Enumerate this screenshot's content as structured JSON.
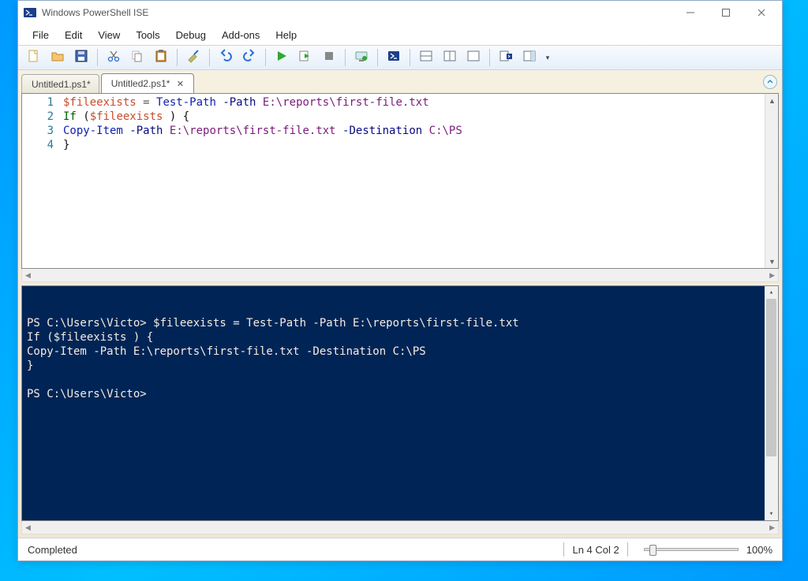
{
  "titlebar": {
    "title": "Windows PowerShell ISE"
  },
  "menubar": [
    "File",
    "Edit",
    "View",
    "Tools",
    "Debug",
    "Add-ons",
    "Help"
  ],
  "toolbar": [
    "new-file",
    "open-file",
    "save-file",
    "|",
    "cut",
    "copy",
    "paste",
    "|",
    "clear",
    "|",
    "undo",
    "redo",
    "|",
    "run",
    "run-selection",
    "stop",
    "|",
    "remote",
    "|",
    "powershell-tab",
    "|",
    "layout-1",
    "layout-2",
    "layout-3",
    "|",
    "show-command",
    "show-command-addon"
  ],
  "tabs": [
    {
      "label": "Untitled1.ps1*",
      "active": false,
      "closable": false
    },
    {
      "label": "Untitled2.ps1*",
      "active": true,
      "closable": true
    }
  ],
  "editor": {
    "line_numbers": [
      "1",
      "2",
      "3",
      "4"
    ],
    "lines": [
      [
        {
          "c": "tok-var",
          "t": "$fileexists"
        },
        {
          "c": "",
          "t": " "
        },
        {
          "c": "tok-op",
          "t": "="
        },
        {
          "c": "",
          "t": " "
        },
        {
          "c": "tok-cmd",
          "t": "Test-Path"
        },
        {
          "c": "",
          "t": " "
        },
        {
          "c": "tok-param",
          "t": "-Path"
        },
        {
          "c": "",
          "t": " "
        },
        {
          "c": "tok-path",
          "t": "E:\\reports\\first-file.txt"
        }
      ],
      [
        {
          "c": "tok-kw",
          "t": "If"
        },
        {
          "c": "",
          "t": " "
        },
        {
          "c": "tok-brace",
          "t": "("
        },
        {
          "c": "tok-var",
          "t": "$fileexists"
        },
        {
          "c": "",
          "t": " "
        },
        {
          "c": "tok-brace",
          "t": ")"
        },
        {
          "c": "",
          "t": " "
        },
        {
          "c": "tok-brace",
          "t": "{"
        }
      ],
      [
        {
          "c": "tok-cmd",
          "t": "Copy-Item"
        },
        {
          "c": "",
          "t": " "
        },
        {
          "c": "tok-param",
          "t": "-Path"
        },
        {
          "c": "",
          "t": " "
        },
        {
          "c": "tok-path",
          "t": "E:\\reports\\first-file.txt"
        },
        {
          "c": "",
          "t": " "
        },
        {
          "c": "tok-param",
          "t": "-Destination"
        },
        {
          "c": "",
          "t": " "
        },
        {
          "c": "tok-path",
          "t": "C:\\PS"
        }
      ],
      [
        {
          "c": "tok-brace",
          "t": "}"
        }
      ]
    ]
  },
  "console": {
    "lines": [
      "PS C:\\Users\\Victo> $fileexists = Test-Path -Path E:\\reports\\first-file.txt",
      "If ($fileexists ) {",
      "Copy-Item -Path E:\\reports\\first-file.txt -Destination C:\\PS",
      "}",
      "",
      "PS C:\\Users\\Victo>"
    ]
  },
  "statusbar": {
    "status": "Completed",
    "position": "Ln 4  Col 2",
    "zoom": "100%"
  }
}
